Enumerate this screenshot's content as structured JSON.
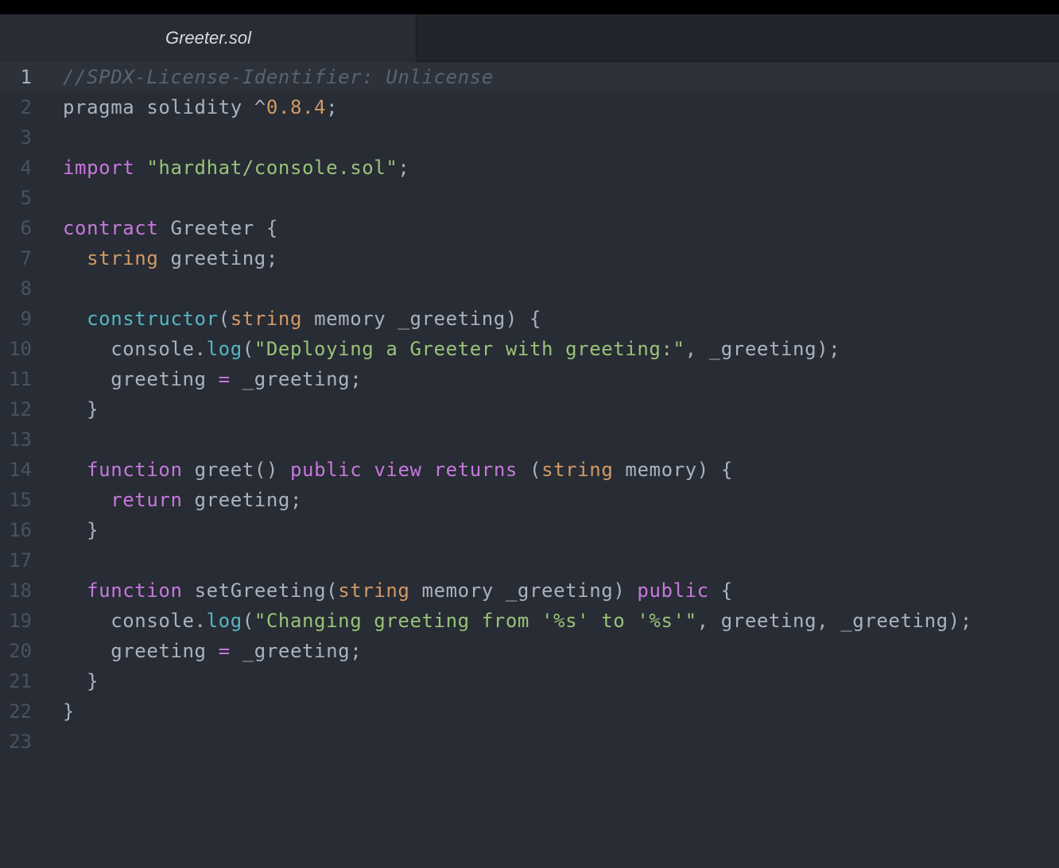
{
  "tab": {
    "title": "Greeter.sol"
  },
  "theme": {
    "background": "#282c34",
    "comment": "#5c6370",
    "keyword": "#c678dd",
    "string": "#98c379",
    "number": "#d19a66",
    "function": "#61afef",
    "builtin": "#56b6c2",
    "plain": "#abb2bf"
  },
  "editor": {
    "active_line": 1,
    "lines": [
      {
        "n": "1",
        "tokens": [
          {
            "t": "//SPDX-License-Identifier: Unlicense",
            "k": "comment"
          }
        ]
      },
      {
        "n": "2",
        "tokens": [
          {
            "t": "pragma solidity ^",
            "k": "plain"
          },
          {
            "t": "0.8.4",
            "k": "number"
          },
          {
            "t": ";",
            "k": "plain"
          }
        ]
      },
      {
        "n": "3",
        "tokens": []
      },
      {
        "n": "4",
        "tokens": [
          {
            "t": "import",
            "k": "keyword"
          },
          {
            "t": " ",
            "k": "plain"
          },
          {
            "t": "\"hardhat/console.sol\"",
            "k": "string"
          },
          {
            "t": ";",
            "k": "plain"
          }
        ]
      },
      {
        "n": "5",
        "tokens": []
      },
      {
        "n": "6",
        "tokens": [
          {
            "t": "contract",
            "k": "keyword"
          },
          {
            "t": " ",
            "k": "plain"
          },
          {
            "t": "Greeter",
            "k": "function"
          },
          {
            "t": " {",
            "k": "plain"
          }
        ]
      },
      {
        "n": "7",
        "tokens": [
          {
            "t": "  ",
            "k": "plain"
          },
          {
            "t": "string",
            "k": "type"
          },
          {
            "t": " greeting;",
            "k": "plain"
          }
        ]
      },
      {
        "n": "8",
        "tokens": []
      },
      {
        "n": "9",
        "tokens": [
          {
            "t": "  ",
            "k": "plain"
          },
          {
            "t": "constructor",
            "k": "builtin"
          },
          {
            "t": "(",
            "k": "plain"
          },
          {
            "t": "string",
            "k": "type"
          },
          {
            "t": " memory _greeting) {",
            "k": "plain"
          }
        ]
      },
      {
        "n": "10",
        "tokens": [
          {
            "t": "    console.",
            "k": "plain"
          },
          {
            "t": "log",
            "k": "builtin"
          },
          {
            "t": "(",
            "k": "plain"
          },
          {
            "t": "\"Deploying a Greeter with greeting:\"",
            "k": "string"
          },
          {
            "t": ", _greeting);",
            "k": "plain"
          }
        ]
      },
      {
        "n": "11",
        "tokens": [
          {
            "t": "    greeting ",
            "k": "plain"
          },
          {
            "t": "=",
            "k": "keyword"
          },
          {
            "t": " _greeting;",
            "k": "plain"
          }
        ]
      },
      {
        "n": "12",
        "tokens": [
          {
            "t": "  }",
            "k": "plain"
          }
        ]
      },
      {
        "n": "13",
        "tokens": []
      },
      {
        "n": "14",
        "tokens": [
          {
            "t": "  ",
            "k": "plain"
          },
          {
            "t": "function",
            "k": "keyword"
          },
          {
            "t": " ",
            "k": "plain"
          },
          {
            "t": "greet",
            "k": "function"
          },
          {
            "t": "() ",
            "k": "plain"
          },
          {
            "t": "public",
            "k": "keyword"
          },
          {
            "t": " ",
            "k": "plain"
          },
          {
            "t": "view",
            "k": "keyword"
          },
          {
            "t": " ",
            "k": "plain"
          },
          {
            "t": "returns",
            "k": "keyword"
          },
          {
            "t": " (",
            "k": "plain"
          },
          {
            "t": "string",
            "k": "type"
          },
          {
            "t": " memory) {",
            "k": "plain"
          }
        ]
      },
      {
        "n": "15",
        "tokens": [
          {
            "t": "    ",
            "k": "plain"
          },
          {
            "t": "return",
            "k": "keyword"
          },
          {
            "t": " greeting;",
            "k": "plain"
          }
        ]
      },
      {
        "n": "16",
        "tokens": [
          {
            "t": "  }",
            "k": "plain"
          }
        ]
      },
      {
        "n": "17",
        "tokens": []
      },
      {
        "n": "18",
        "tokens": [
          {
            "t": "  ",
            "k": "plain"
          },
          {
            "t": "function",
            "k": "keyword"
          },
          {
            "t": " ",
            "k": "plain"
          },
          {
            "t": "setGreeting",
            "k": "function"
          },
          {
            "t": "(",
            "k": "plain"
          },
          {
            "t": "string",
            "k": "type"
          },
          {
            "t": " memory _greeting) ",
            "k": "plain"
          },
          {
            "t": "public",
            "k": "keyword"
          },
          {
            "t": " {",
            "k": "plain"
          }
        ]
      },
      {
        "n": "19",
        "tokens": [
          {
            "t": "    console.",
            "k": "plain"
          },
          {
            "t": "log",
            "k": "builtin"
          },
          {
            "t": "(",
            "k": "plain"
          },
          {
            "t": "\"Changing greeting from '%s' to '%s'\"",
            "k": "string"
          },
          {
            "t": ", greeting, _greeting);",
            "k": "plain"
          }
        ]
      },
      {
        "n": "20",
        "tokens": [
          {
            "t": "    greeting ",
            "k": "plain"
          },
          {
            "t": "=",
            "k": "keyword"
          },
          {
            "t": " _greeting;",
            "k": "plain"
          }
        ]
      },
      {
        "n": "21",
        "tokens": [
          {
            "t": "  }",
            "k": "plain"
          }
        ]
      },
      {
        "n": "22",
        "tokens": [
          {
            "t": "}",
            "k": "plain"
          }
        ]
      },
      {
        "n": "23",
        "tokens": []
      }
    ]
  }
}
